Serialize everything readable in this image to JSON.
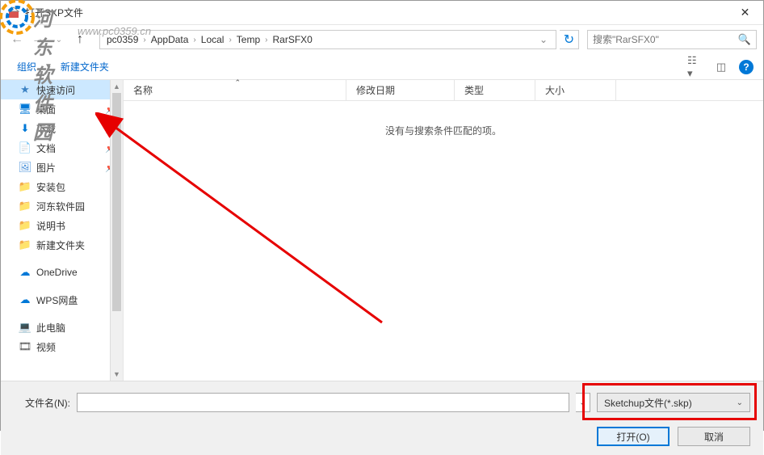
{
  "window": {
    "title": "打开SKP文件"
  },
  "watermark": {
    "text": "河东软件园",
    "url": "www.pc0359.cn"
  },
  "breadcrumb": {
    "items": [
      "pc0359",
      "AppData",
      "Local",
      "Temp",
      "RarSFX0"
    ]
  },
  "search": {
    "placeholder": "搜索\"RarSFX0\""
  },
  "toolbar": {
    "organize": "组织",
    "newfolder": "新建文件夹"
  },
  "sidebar": {
    "items": [
      {
        "label": "快速访问",
        "icon": "star",
        "color": "#3b82c4",
        "selected": true
      },
      {
        "label": "桌面",
        "icon": "desktop",
        "color": "#0078d7",
        "pinned": true
      },
      {
        "label": "下载",
        "icon": "download",
        "color": "#0078d7",
        "pinned": true
      },
      {
        "label": "文档",
        "icon": "doc",
        "color": "#4a90d9",
        "pinned": true
      },
      {
        "label": "图片",
        "icon": "picture",
        "color": "#4a90d9",
        "pinned": true
      },
      {
        "label": "安装包",
        "icon": "folder",
        "color": "#ffb900"
      },
      {
        "label": "河东软件园",
        "icon": "folder",
        "color": "#ffb900"
      },
      {
        "label": "说明书",
        "icon": "folder",
        "color": "#ffb900"
      },
      {
        "label": "新建文件夹",
        "icon": "folder",
        "color": "#ffb900"
      },
      {
        "label": "OneDrive",
        "icon": "cloud",
        "color": "#0078d7",
        "spaceBefore": true
      },
      {
        "label": "WPS网盘",
        "icon": "cloud2",
        "color": "#0078d7",
        "spaceBefore": true
      },
      {
        "label": "此电脑",
        "icon": "pc",
        "color": "#0078d7",
        "spaceBefore": true
      },
      {
        "label": "视频",
        "icon": "video",
        "color": "#555"
      }
    ]
  },
  "columns": {
    "name": "名称",
    "date": "修改日期",
    "type": "类型",
    "size": "大小"
  },
  "content": {
    "empty": "没有与搜索条件匹配的项。"
  },
  "footer": {
    "filename_label": "文件名(N):",
    "filter": "Sketchup文件(*.skp)",
    "open": "打开(O)",
    "cancel": "取消"
  }
}
